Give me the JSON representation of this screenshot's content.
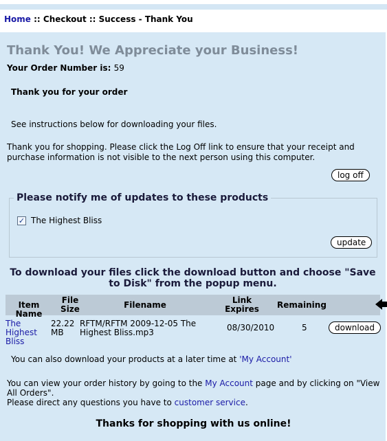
{
  "breadcrumb": {
    "home": "Home",
    "sep1": " :: ",
    "checkout": "Checkout",
    "sep2": " :: ",
    "current": "Success - Thank You"
  },
  "heading": "Thank You! We Appreciate your Business!",
  "order": {
    "label": "Your Order Number is:",
    "number": "59"
  },
  "thanks_text": "Thank you for your order",
  "instructions": "See instructions below for downloading your files.",
  "logoff_text": "Thank you for shopping. Please click the Log Off link to ensure that your receipt and purchase information is not visible to the next person using this computer.",
  "logoff_button": "log off",
  "notify": {
    "legend": "Please notify me of updates to these products",
    "product": "The Highest Bliss",
    "checkmark": "✓",
    "update_button": "update"
  },
  "download": {
    "heading": "To download your files click the download button and choose \"Save to Disk\" from the popup menu.",
    "columns": {
      "item": "Item Name",
      "size": "File Size",
      "filename": "Filename",
      "expires": "Link Expires",
      "remaining": "Remaining"
    },
    "row": {
      "item": "The Highest Bliss",
      "size": "22.22 MB",
      "filename": "RFTM/RFTM 2009-12-05 The Highest Bliss.mp3",
      "expires": "08/30/2010",
      "remaining": "5",
      "button": "download"
    }
  },
  "later": {
    "text": "You can also download your products at a later time at ",
    "link": "'My Account'"
  },
  "history": {
    "text1": "You can view your order history by going to the ",
    "link1": "My Account",
    "text2": " page and by clicking on \"View All Orders\".",
    "text3": "Please direct any questions you have to ",
    "link2": "customer service",
    "text4": "."
  },
  "final_message": "Thanks for shopping with us online!"
}
